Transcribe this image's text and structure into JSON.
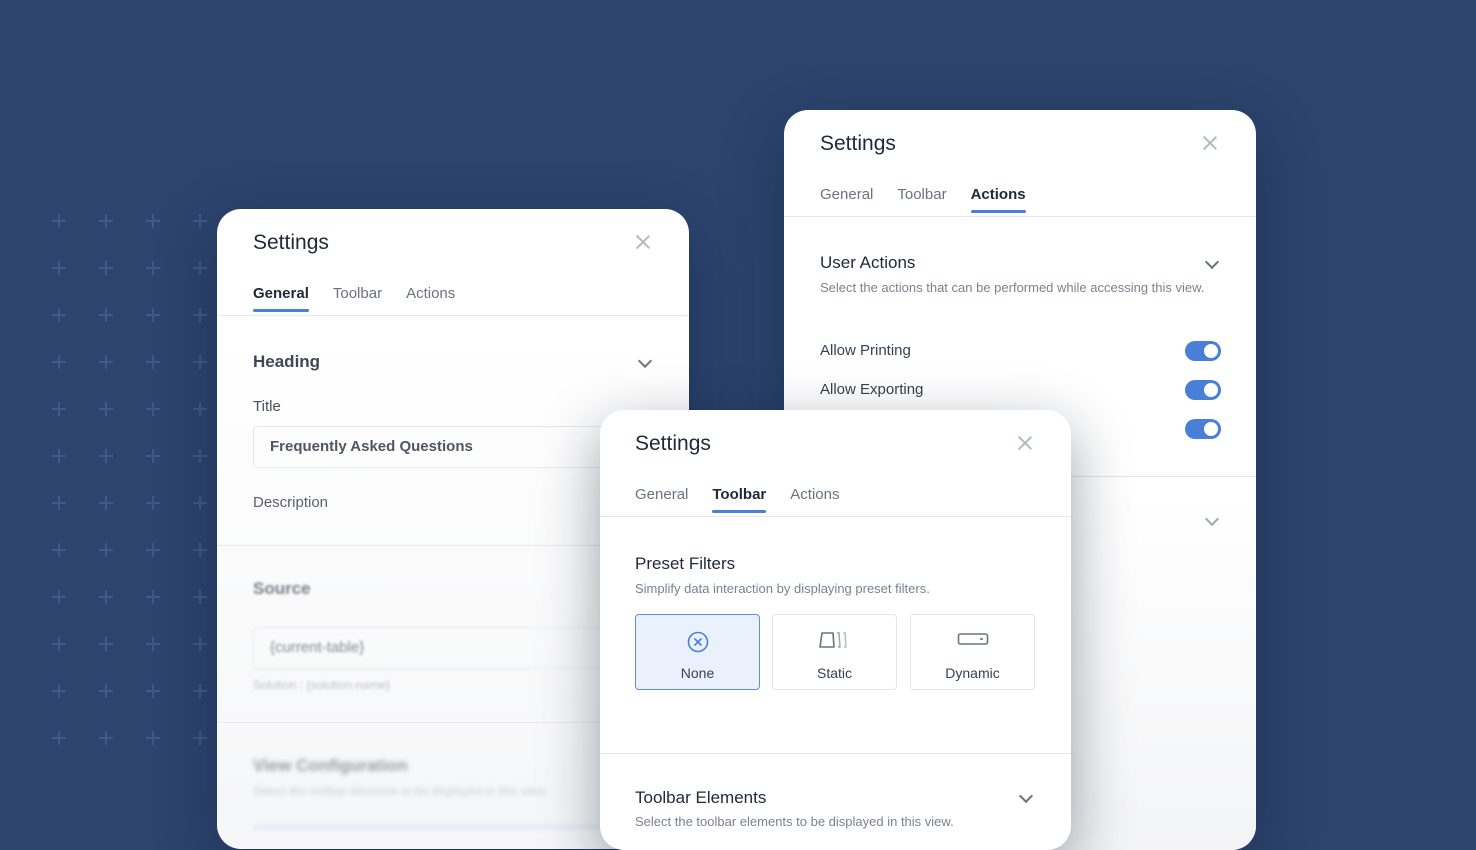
{
  "left_panel": {
    "title": "Settings",
    "tabs": [
      "General",
      "Toolbar",
      "Actions"
    ],
    "heading_section": {
      "title": "Heading"
    },
    "title_field": {
      "label": "Title",
      "value": "Frequently Asked Questions"
    },
    "description_field": {
      "label": "Description"
    },
    "source_section": {
      "title": "Source",
      "value": "{current-table}",
      "hint": "Solution : {solution-name}"
    },
    "view_config": {
      "title": "View Configuration",
      "desc": "Select the toolbar elements to be displayed in this view."
    }
  },
  "right_panel": {
    "title": "Settings",
    "tabs": [
      "General",
      "Toolbar",
      "Actions"
    ],
    "user_actions": {
      "title": "User Actions",
      "desc": "Select the actions that can be performed while accessing this view."
    },
    "toggles": [
      {
        "label": "Allow Printing",
        "on": true
      },
      {
        "label": "Allow Exporting",
        "on": true
      },
      {
        "label": "",
        "on": true
      }
    ]
  },
  "front_panel": {
    "title": "Settings",
    "tabs": [
      "General",
      "Toolbar",
      "Actions"
    ],
    "preset_filters": {
      "title": "Preset Filters",
      "desc": "Simplify data interaction by displaying preset filters.",
      "options": [
        {
          "label": "None",
          "icon": "circle-x-icon",
          "selected": true
        },
        {
          "label": "Static",
          "icon": "static-tags-icon",
          "selected": false
        },
        {
          "label": "Dynamic",
          "icon": "dynamic-bar-icon",
          "selected": false
        }
      ]
    },
    "toolbar_elements": {
      "title": "Toolbar Elements",
      "desc": "Select the toolbar elements to be displayed in this view."
    }
  },
  "colors": {
    "background": "#2c446e",
    "accent": "#4a7fd8",
    "selected_bg": "#eaf1fd"
  }
}
